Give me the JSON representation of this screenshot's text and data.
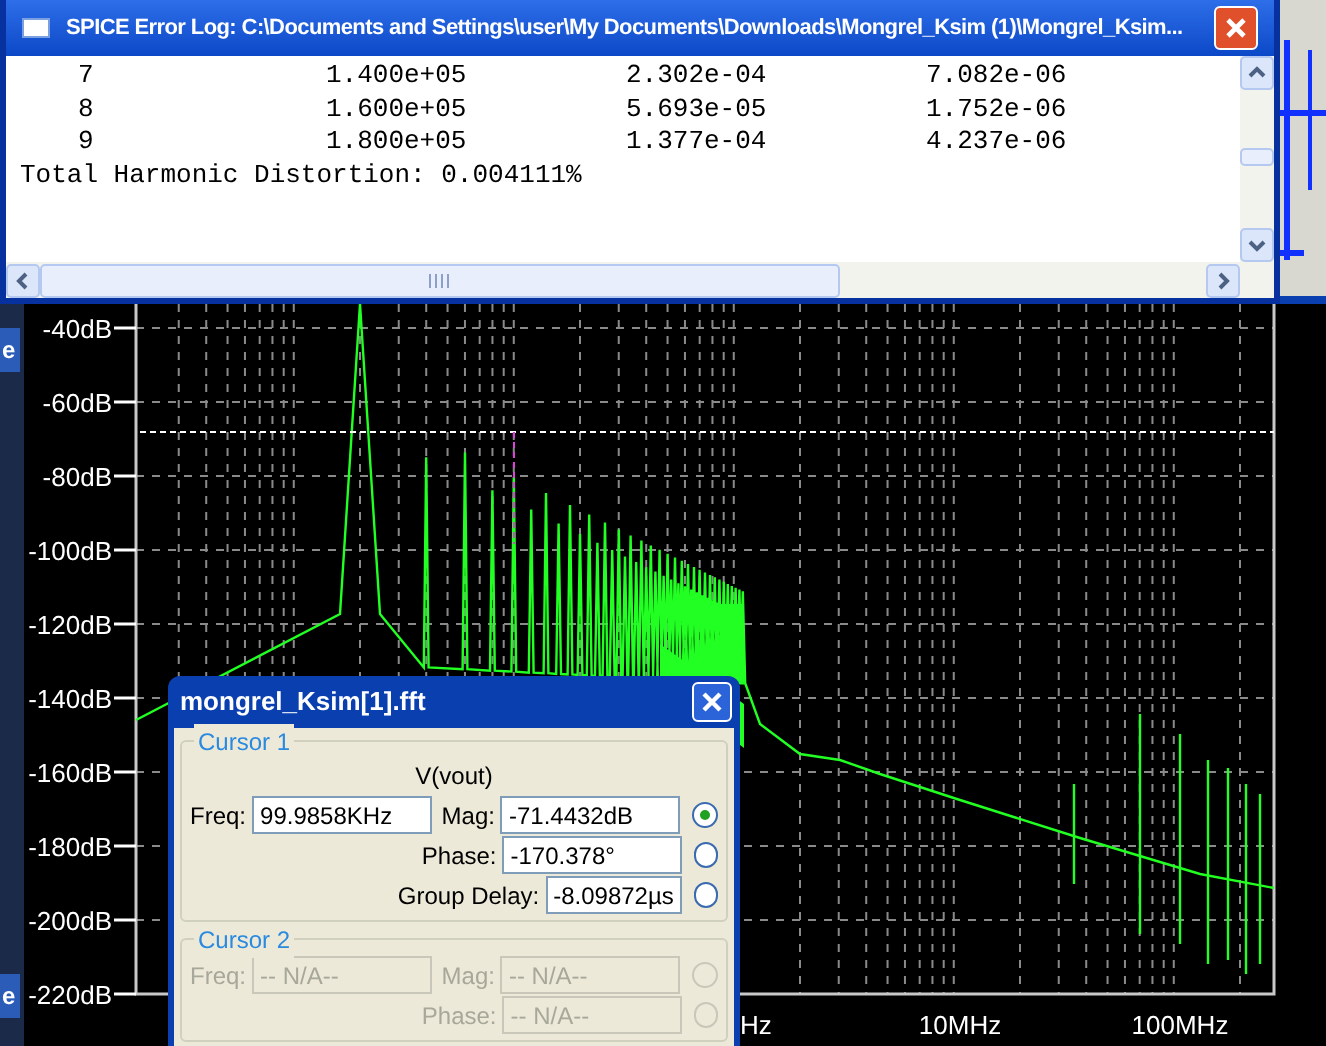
{
  "error_log": {
    "title": "SPICE Error Log: C:\\Documents and Settings\\user\\My Documents\\Downloads\\Mongrel_Ksim (1)\\Mongrel_Ksim...",
    "rows": [
      [
        "7",
        "1.400e+05",
        "2.302e-04",
        "7.082e-06"
      ],
      [
        "8",
        "1.600e+05",
        "5.693e-05",
        "1.752e-06"
      ],
      [
        "9",
        "1.800e+05",
        "1.377e-04",
        "4.237e-06"
      ]
    ],
    "summary": "Total Harmonic Distortion: 0.004111%"
  },
  "background_fragments": [
    "e",
    "e"
  ],
  "plot": {
    "y_ticks": [
      "-40dB",
      "-60dB",
      "-80dB",
      "-100dB",
      "-120dB",
      "-140dB",
      "-160dB",
      "-180dB",
      "-200dB",
      "-220dB"
    ],
    "x_ticks": [
      "Hz",
      "10MHz",
      "100MHz"
    ]
  },
  "cursor_dialog": {
    "title": "mongrel_Ksim[1].fft",
    "groups": [
      {
        "label": "Cursor 1",
        "enabled": true,
        "trace": "V(vout)",
        "fields": [
          {
            "label": "Freq:",
            "value": "99.9858KHz"
          },
          {
            "label": "Mag:",
            "value": "-71.4432dB",
            "selected": true
          },
          {
            "label": "Phase:",
            "value": "-170.378°",
            "selected": false
          },
          {
            "label": "Group Delay:",
            "value": "-8.09872µs",
            "selected": false
          }
        ]
      },
      {
        "label": "Cursor 2",
        "enabled": false,
        "fields": [
          {
            "label": "Freq:",
            "value": "-- N/A--"
          },
          {
            "label": "Mag:",
            "value": "-- N/A--",
            "selected": false
          },
          {
            "label": "Phase:",
            "value": "-- N/A--",
            "selected": false
          }
        ]
      }
    ]
  }
}
